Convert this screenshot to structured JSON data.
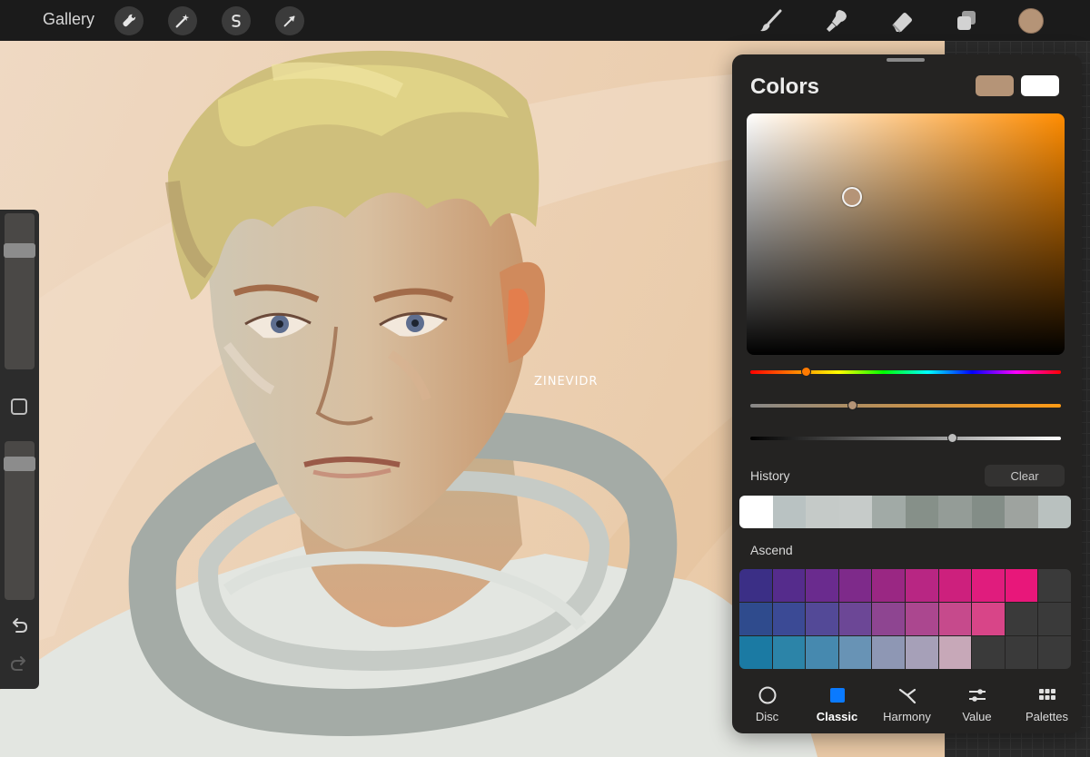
{
  "topbar": {
    "gallery_label": "Gallery",
    "tools": [
      "wrench-icon",
      "magic-wand-icon",
      "selection-icon",
      "transform-arrow-icon"
    ],
    "right_tools": [
      "brush-icon",
      "smudge-icon",
      "eraser-icon",
      "layers-icon"
    ],
    "current_color": "#b59477"
  },
  "canvas": {
    "signature": "ZINEVIDR"
  },
  "colors_panel": {
    "title": "Colors",
    "primary_color": "#b59477",
    "secondary_color": "#ffffff",
    "hue_position": 0.18,
    "saturation_position": 0.33,
    "brightness_position": 0.65,
    "history_label": "History",
    "clear_label": "Clear",
    "history": [
      "#ffffff",
      "#b9c2c2",
      "#c5cac8",
      "#c6cbc9",
      "#a1aaa6",
      "#869089",
      "#949c97",
      "#838d87",
      "#9ea39f",
      "#b9c1bf"
    ],
    "palette_name": "Ascend",
    "palette": [
      [
        "#3b2f86",
        "#552c8c",
        "#6a2b8e",
        "#7e2a8a",
        "#9a2783",
        "#b82683",
        "#cd207d",
        "#e01c7d",
        "#e8177a",
        "#3a3a3a"
      ],
      [
        "#2f4b8d",
        "#3b4a95",
        "#534997",
        "#6c4796",
        "#8e4591",
        "#ab478f",
        "#c64a8c",
        "#d84588",
        "#3a3a3a",
        "#3a3a3a"
      ],
      [
        "#1b7aa3",
        "#2c84a8",
        "#4689af",
        "#6893b5",
        "#8e97b4",
        "#a6a0b8",
        "#c7a8b8",
        "#3a3a3a",
        "#3a3a3a",
        "#3a3a3a"
      ]
    ],
    "tabs": [
      {
        "label": "Disc",
        "icon": "disc-icon"
      },
      {
        "label": "Classic",
        "icon": "classic-square-icon"
      },
      {
        "label": "Harmony",
        "icon": "harmony-icon"
      },
      {
        "label": "Value",
        "icon": "sliders-icon"
      },
      {
        "label": "Palettes",
        "icon": "grid-icon"
      }
    ],
    "active_tab": "Classic"
  },
  "sidebar": {
    "brush_size": 0.79,
    "opacity": 0.89
  }
}
